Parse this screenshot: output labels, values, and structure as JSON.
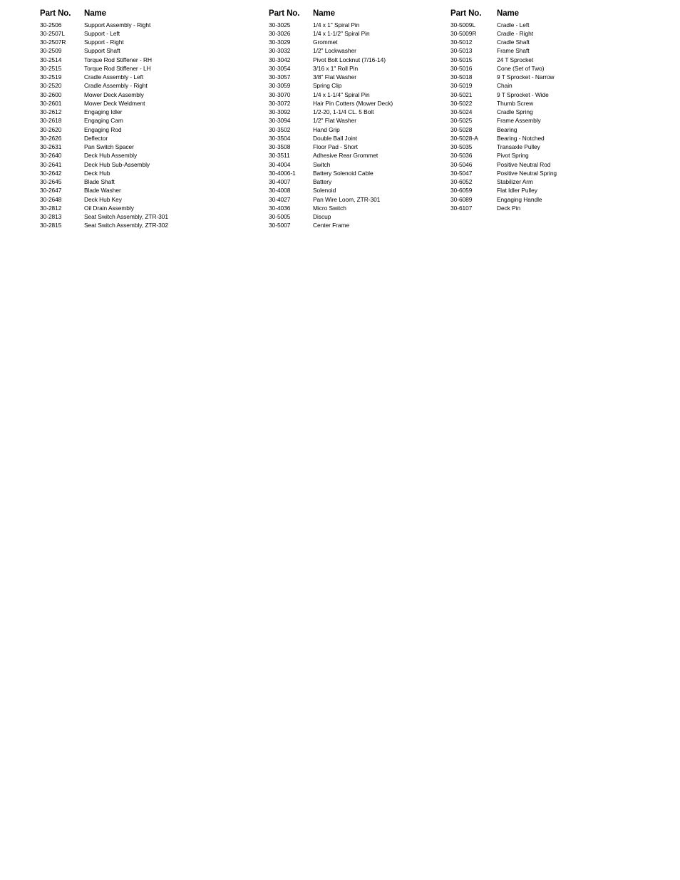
{
  "document": {
    "type": "parts-list",
    "background_color": "#ffffff",
    "text_color": "#000000"
  },
  "columns": [
    {
      "id": "column-1",
      "headers": {
        "part_no": "Part No.",
        "name": "Name"
      },
      "rows": [
        {
          "part_no": "30-2506",
          "name": "Support Assembly - Right"
        },
        {
          "part_no": "30-2507L",
          "name": "Support - Left"
        },
        {
          "part_no": "30-2507R",
          "name": "Support - Right"
        },
        {
          "part_no": "30-2509",
          "name": "Support Shaft"
        },
        {
          "part_no": "30-2514",
          "name": "Torque Rod Stiffener - RH"
        },
        {
          "part_no": "30-2515",
          "name": "Torque Rod Stiffener - LH"
        },
        {
          "part_no": "30-2519",
          "name": "Cradle Assembly - Left"
        },
        {
          "part_no": "30-2520",
          "name": "Cradle Assembly - Right"
        },
        {
          "part_no": "30-2600",
          "name": "Mower Deck Assembly"
        },
        {
          "part_no": "30-2601",
          "name": "Mower Deck Weldment"
        },
        {
          "part_no": "30-2612",
          "name": "Engaging Idler"
        },
        {
          "part_no": "30-2618",
          "name": "Engaging Cam"
        },
        {
          "part_no": "30-2620",
          "name": "Engaging Rod"
        },
        {
          "part_no": "30-2626",
          "name": "Deflector"
        },
        {
          "part_no": "30-2631",
          "name": "Pan Switch Spacer"
        },
        {
          "part_no": "30-2640",
          "name": "Deck Hub Assembly"
        },
        {
          "part_no": "30-2641",
          "name": "Deck Hub Sub-Assembly"
        },
        {
          "part_no": "30-2642",
          "name": "Deck Hub"
        },
        {
          "part_no": "30-2645",
          "name": "Blade Shaft"
        },
        {
          "part_no": "30-2647",
          "name": "Blade Washer"
        },
        {
          "part_no": "30-2648",
          "name": "Deck Hub Key"
        },
        {
          "part_no": "30-2812",
          "name": "Oil Drain Assembly"
        },
        {
          "part_no": "30-2813",
          "name": "Seat Switch Assembly, ZTR-301"
        },
        {
          "part_no": "30-2815",
          "name": "Seat Switch Assembly, ZTR-302"
        }
      ]
    },
    {
      "id": "column-2",
      "headers": {
        "part_no": "Part No.",
        "name": "Name"
      },
      "rows": [
        {
          "part_no": "30-3025",
          "name": "1/4 x 1\" Spiral Pin"
        },
        {
          "part_no": "30-3026",
          "name": "1/4 x 1-1/2\" Spiral Pin"
        },
        {
          "part_no": "30-3029",
          "name": "Grommet"
        },
        {
          "part_no": "30-3032",
          "name": "1/2\" Lockwasher"
        },
        {
          "part_no": "30-3042",
          "name": "Pivot Bolt Locknut (7/16-14)"
        },
        {
          "part_no": "30-3054",
          "name": "3/16 x 1\" Roll Pin"
        },
        {
          "part_no": "30-3057",
          "name": "3/8\" Flat Washer"
        },
        {
          "part_no": "30-3059",
          "name": "Spring Clip"
        },
        {
          "part_no": "30-3070",
          "name": "1/4 x 1-1/4\" Spiral Pin"
        },
        {
          "part_no": "30-3072",
          "name": "Hair Pin Cotters (Mower Deck)"
        },
        {
          "part_no": "30-3092",
          "name": "1/2-20, 1-1/4 CL. 5 Bolt"
        },
        {
          "part_no": "30-3094",
          "name": "1/2\" Flat Washer"
        },
        {
          "part_no": "30-3502",
          "name": "Hand Grip"
        },
        {
          "part_no": "30-3504",
          "name": "Double Ball Joint"
        },
        {
          "part_no": "30-3508",
          "name": "Floor Pad - Short"
        },
        {
          "part_no": "30-3511",
          "name": "Adhesive Rear Grommet"
        },
        {
          "part_no": "30-4004",
          "name": "Switch"
        },
        {
          "part_no": "30-4006-1",
          "name": "Battery Solenoid Cable"
        },
        {
          "part_no": "30-4007",
          "name": "Battery"
        },
        {
          "part_no": "30-4008",
          "name": "Solenoid"
        },
        {
          "part_no": "30-4027",
          "name": "Pan Wire Loom, ZTR-301"
        },
        {
          "part_no": "30-4036",
          "name": "Micro Switch"
        },
        {
          "part_no": "30-5005",
          "name": "Discup"
        },
        {
          "part_no": "30-5007",
          "name": "Center Frame"
        }
      ]
    },
    {
      "id": "column-3",
      "headers": {
        "part_no": "Part No.",
        "name": "Name"
      },
      "rows": [
        {
          "part_no": "30-5009L",
          "name": "Cradle - Left"
        },
        {
          "part_no": "30-5009R",
          "name": "Cradle - Right"
        },
        {
          "part_no": "30-5012",
          "name": "Cradle Shaft"
        },
        {
          "part_no": "30-5013",
          "name": "Frame Shaft"
        },
        {
          "part_no": "30-5015",
          "name": "24 T Sprocket"
        },
        {
          "part_no": "30-5016",
          "name": "Cone (Set of Two)"
        },
        {
          "part_no": "30-5018",
          "name": "9 T Sprocket - Narrow"
        },
        {
          "part_no": "30-5019",
          "name": "Chain"
        },
        {
          "part_no": "30-5021",
          "name": "9 T Sprocket - Wide"
        },
        {
          "part_no": "30-5022",
          "name": "Thumb Screw"
        },
        {
          "part_no": "30-5024",
          "name": "Cradle Spring"
        },
        {
          "part_no": "30-5025",
          "name": "Frame Assembly"
        },
        {
          "part_no": "30-5028",
          "name": "Bearing"
        },
        {
          "part_no": "30-5028-A",
          "name": "Bearing - Notched"
        },
        {
          "part_no": "30-5035",
          "name": "Transaxle Pulley"
        },
        {
          "part_no": "30-5036",
          "name": "Pivot Spring"
        },
        {
          "part_no": "30-5046",
          "name": "Positive Neutral Rod"
        },
        {
          "part_no": "30-5047",
          "name": "Positive Neutral Spring"
        },
        {
          "part_no": "30-6052",
          "name": "Stabilizer Arm"
        },
        {
          "part_no": "30-6059",
          "name": "Flat Idler Pulley"
        },
        {
          "part_no": "30-6089",
          "name": "Engaging Handle"
        },
        {
          "part_no": "30-6107",
          "name": "Deck Pin"
        }
      ]
    }
  ]
}
